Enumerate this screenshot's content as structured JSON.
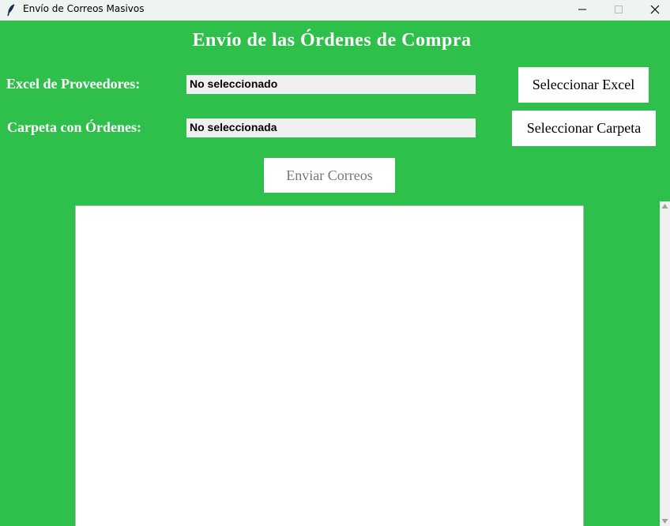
{
  "window": {
    "title": "Envío de Correos Masivos",
    "icons": {
      "app": "feather-icon",
      "minimize": "minimize-icon",
      "maximize": "maximize-icon",
      "close": "close-icon"
    }
  },
  "main": {
    "title": "Envío de las Órdenes de Compra",
    "excel": {
      "label": "Excel de Proveedores:",
      "value": "No seleccionado",
      "button": "Seleccionar Excel"
    },
    "folder": {
      "label": "Carpeta con Órdenes:",
      "value": "No seleccionada",
      "button": "Seleccionar Carpeta"
    },
    "send_button": "Enviar Correos",
    "log_text": ""
  },
  "colors": {
    "background": "#2ec04a",
    "titlebar": "#eef4f0",
    "text_light": "#ffffff",
    "disabled_text": "#777777"
  }
}
